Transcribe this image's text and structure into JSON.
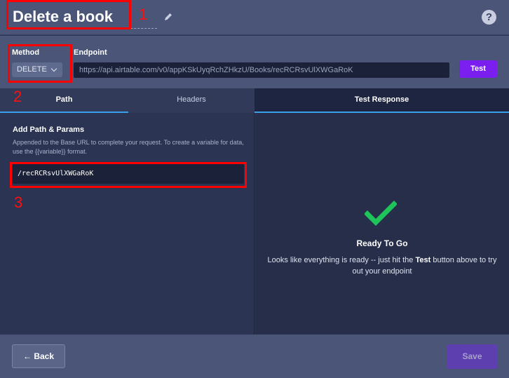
{
  "header": {
    "title": "Delete a book",
    "edit_icon": "pencil-icon",
    "help_icon": "question-circle-icon",
    "help_glyph": "?"
  },
  "request": {
    "method_label": "Method",
    "method_value": "DELETE",
    "endpoint_label": "Endpoint",
    "endpoint_value": "https://api.airtable.com/v0/appKSkUyqRchZHkzU/Books/recRCRsvUlXWGaRoK",
    "test_label": "Test"
  },
  "tabs": {
    "path": "Path",
    "headers": "Headers",
    "test_response": "Test Response"
  },
  "params": {
    "title": "Add Path & Params",
    "description": "Appended to the Base URL to complete your request. To create a variable for data, use the {{variable}} format.",
    "path_value": "/recRCRsvUlXWGaRoK"
  },
  "response": {
    "check_icon": "checkmark-icon",
    "title": "Ready To Go",
    "desc_before": "Looks like everything is ready -- just hit the ",
    "desc_bold": "Test",
    "desc_after": " button above to try out your endpoint"
  },
  "footer": {
    "back_label": "← Back",
    "save_label": "Save"
  },
  "annotations": {
    "n1": "1",
    "n2": "2",
    "n3": "3"
  },
  "colors": {
    "accent_purple": "#7a1ff0",
    "tab_underline": "#3aa0e8",
    "check_green": "#1ec45a",
    "annotation_red": "#ff0000"
  }
}
